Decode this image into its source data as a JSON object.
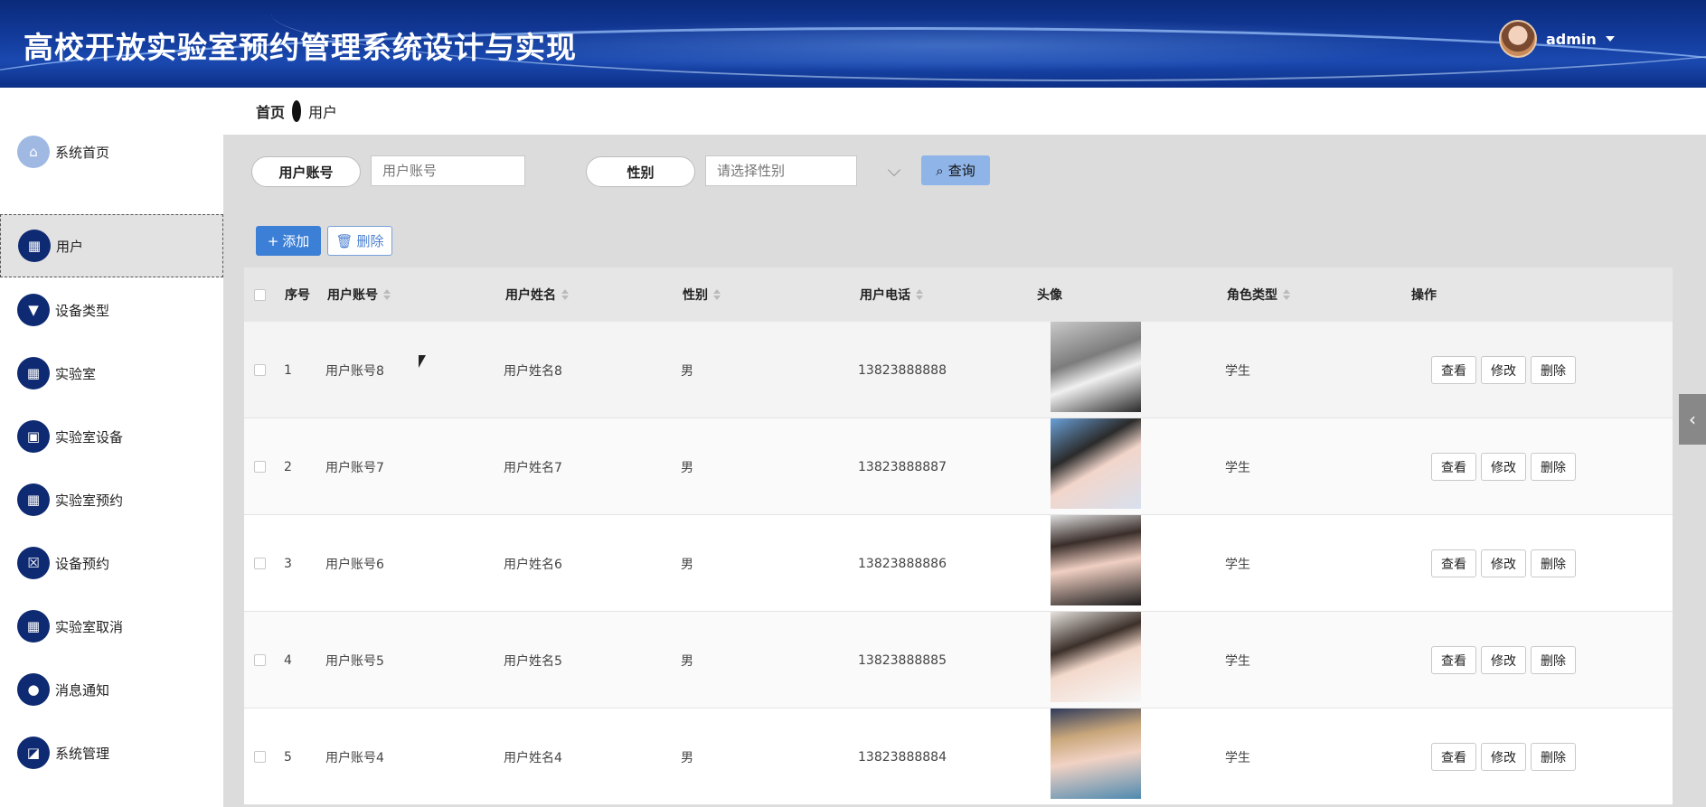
{
  "header": {
    "app_title": "高校开放实验室预约管理系统设计与实现",
    "username": "admin"
  },
  "breadcrumb": {
    "home": "首页",
    "current": "用户"
  },
  "sidebar": {
    "items": [
      {
        "label": "系统首页",
        "icon": "home-icon",
        "active": false
      },
      {
        "label": "用户",
        "icon": "grid-icon",
        "active": true
      },
      {
        "label": "设备类型",
        "icon": "tag-icon",
        "active": false
      },
      {
        "label": "实验室",
        "icon": "grid-icon",
        "active": false
      },
      {
        "label": "实验室设备",
        "icon": "briefcase-icon",
        "active": false
      },
      {
        "label": "实验室预约",
        "icon": "grid-icon",
        "active": false
      },
      {
        "label": "设备预约",
        "icon": "clipboard-icon",
        "active": false
      },
      {
        "label": "实验室取消",
        "icon": "grid-icon",
        "active": false
      },
      {
        "label": "消息通知",
        "icon": "user-icon",
        "active": false
      },
      {
        "label": "系统管理",
        "icon": "chart-icon",
        "active": false
      }
    ]
  },
  "search": {
    "account_label": "用户账号",
    "account_placeholder": "用户账号",
    "gender_label": "性别",
    "gender_placeholder": "请选择性别",
    "query_label": "查询"
  },
  "toolbar": {
    "add_label": "添加",
    "delete_label": "删除"
  },
  "table": {
    "columns": [
      "序号",
      "用户账号",
      "用户姓名",
      "性别",
      "用户电话",
      "头像",
      "角色类型",
      "操作"
    ],
    "rows": [
      {
        "index": "1",
        "account": "用户账号8",
        "name": "用户姓名8",
        "gender": "男",
        "phone": "13823888888",
        "role": "学生"
      },
      {
        "index": "2",
        "account": "用户账号7",
        "name": "用户姓名7",
        "gender": "男",
        "phone": "13823888887",
        "role": "学生"
      },
      {
        "index": "3",
        "account": "用户账号6",
        "name": "用户姓名6",
        "gender": "男",
        "phone": "13823888886",
        "role": "学生"
      },
      {
        "index": "4",
        "account": "用户账号5",
        "name": "用户姓名5",
        "gender": "男",
        "phone": "13823888885",
        "role": "学生"
      },
      {
        "index": "5",
        "account": "用户账号4",
        "name": "用户姓名4",
        "gender": "男",
        "phone": "13823888884",
        "role": "学生"
      }
    ],
    "actions": {
      "view": "查看",
      "edit": "修改",
      "delete": "删除"
    }
  },
  "colors": {
    "header_bg": "#123a9a",
    "sidebar_icon_bg": "#0e2a72",
    "primary_button": "#3c7fd6",
    "query_button": "#8fb4e8"
  }
}
